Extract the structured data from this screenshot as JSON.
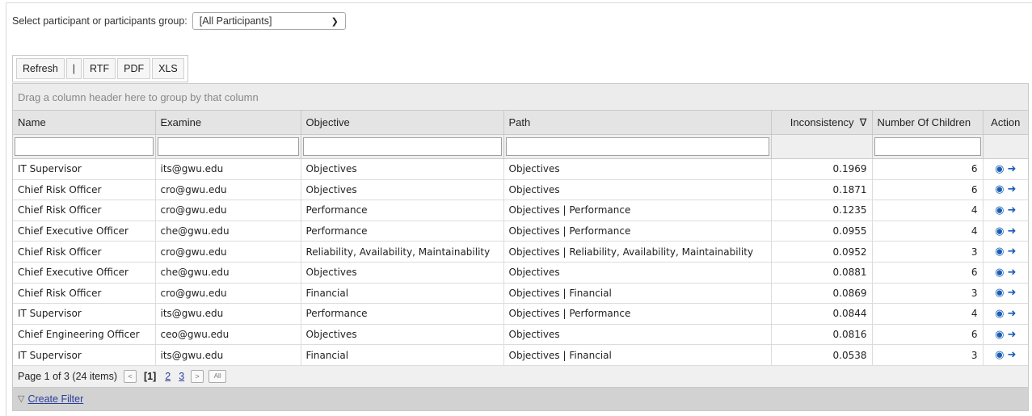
{
  "selector": {
    "label": "Select participant or participants group:",
    "value": "[All Participants]"
  },
  "toolbar": {
    "refresh": "Refresh",
    "separator": "|",
    "rtf": "RTF",
    "pdf": "PDF",
    "xls": "XLS"
  },
  "grid": {
    "group_hint": "Drag a column header here to group by that column",
    "columns": [
      "Name",
      "Examine",
      "Objective",
      "Path",
      "Inconsistency",
      "Number Of Children",
      "Action"
    ],
    "sort_indicator": "∇",
    "rows": [
      [
        "IT Supervisor",
        "its@gwu.edu",
        "Objectives",
        "Objectives",
        "0.1969",
        "6"
      ],
      [
        "Chief Risk Officer",
        "cro@gwu.edu",
        "Objectives",
        "Objectives",
        "0.1871",
        "6"
      ],
      [
        "Chief Risk Officer",
        "cro@gwu.edu",
        "Performance",
        "Objectives | Performance",
        "0.1235",
        "4"
      ],
      [
        "Chief Executive Officer",
        "che@gwu.edu",
        "Performance",
        "Objectives | Performance",
        "0.0955",
        "4"
      ],
      [
        "Chief Risk Officer",
        "cro@gwu.edu",
        "Reliability, Availability, Maintainability",
        "Objectives | Reliability, Availability, Maintainability",
        "0.0952",
        "3"
      ],
      [
        "Chief Executive Officer",
        "che@gwu.edu",
        "Objectives",
        "Objectives",
        "0.0881",
        "6"
      ],
      [
        "Chief Risk Officer",
        "cro@gwu.edu",
        "Financial",
        "Objectives | Financial",
        "0.0869",
        "3"
      ],
      [
        "IT Supervisor",
        "its@gwu.edu",
        "Performance",
        "Objectives | Performance",
        "0.0844",
        "4"
      ],
      [
        "Chief Engineering Officer",
        "ceo@gwu.edu",
        "Objectives",
        "Objectives",
        "0.0816",
        "6"
      ],
      [
        "IT Supervisor",
        "its@gwu.edu",
        "Financial",
        "Objectives | Financial",
        "0.0538",
        "3"
      ]
    ],
    "action_icons": [
      "eye-icon",
      "sign-in-icon"
    ]
  },
  "pager": {
    "summary": "Page 1 of 3 (24 items)",
    "prev": "<",
    "current": "[1]",
    "pages": [
      "2",
      "3"
    ],
    "next": ">",
    "all": "All"
  },
  "filter_bar": {
    "link": "Create Filter"
  },
  "colors": {
    "link": "#2a3d9c",
    "action_icon": "#1a5fb4",
    "header_bg": "#e4e4e4"
  }
}
